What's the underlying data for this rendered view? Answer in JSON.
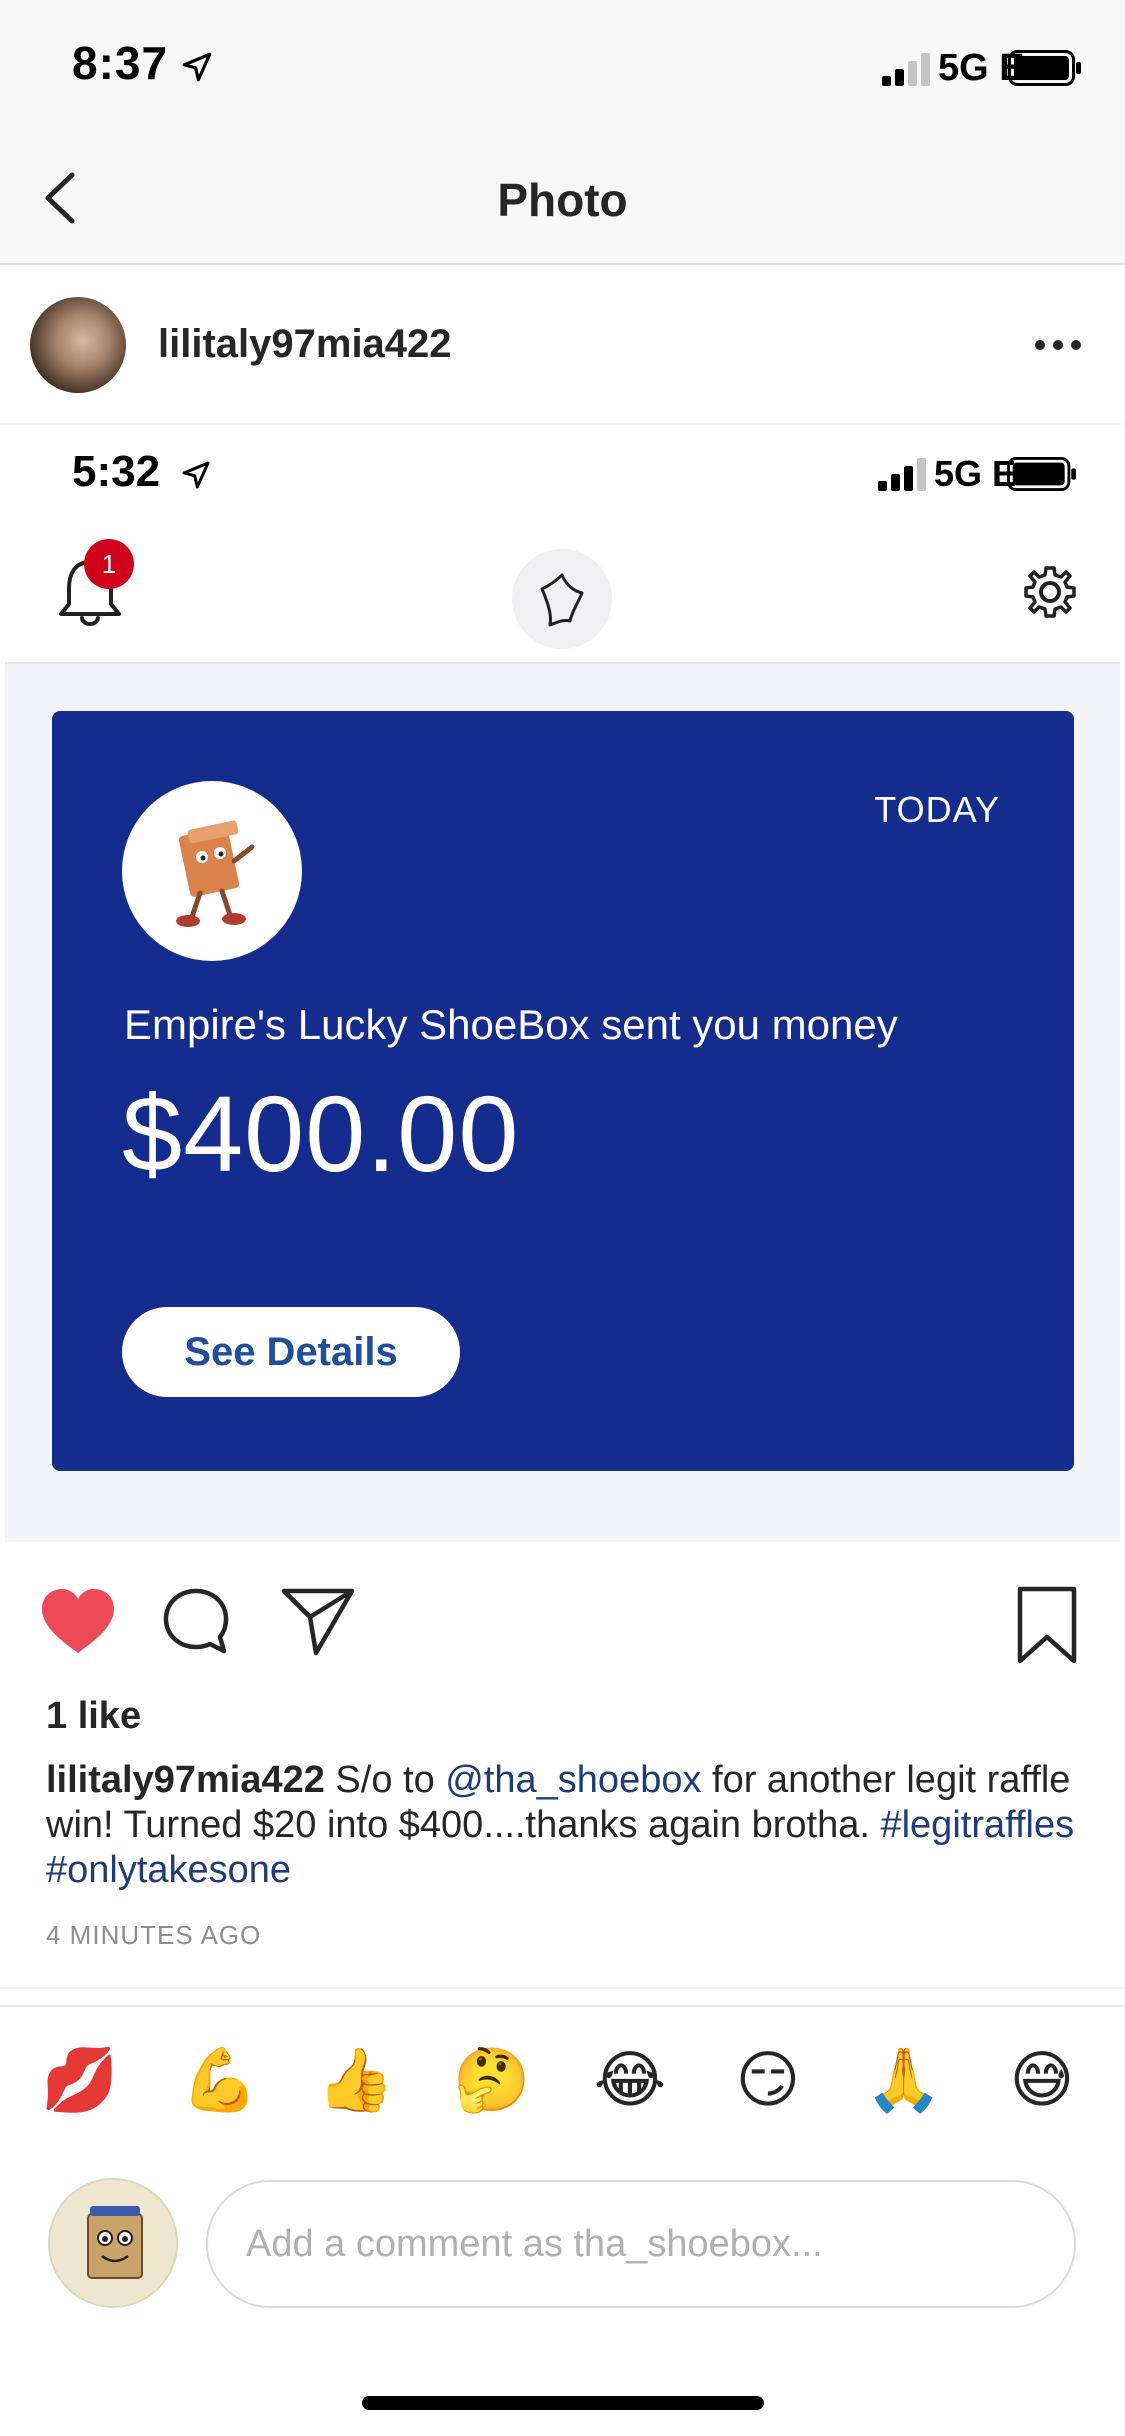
{
  "status_bar": {
    "time": "8:37",
    "network": "5G E"
  },
  "nav": {
    "title": "Photo"
  },
  "post": {
    "username": "lilitaly97mia422",
    "likes": "1 like",
    "caption_user": "lilitaly97mia422",
    "caption_text_1": " S/o to ",
    "caption_mention": "@tha_shoebox",
    "caption_text_2": " for another legit raffle win! Turned $20 into $400....thanks again brotha. ",
    "caption_hashtags": "#legitraffles #onlytakesone",
    "timestamp": "4 MINUTES AGO"
  },
  "inner_screenshot": {
    "status_time": "5:32",
    "network": "5G E",
    "notification_count": "1",
    "card": {
      "date": "TODAY",
      "sender_line": "Empire's Lucky ShoeBox sent you money",
      "amount": "$400.00",
      "button_label": "See Details"
    }
  },
  "emoji_bar": [
    "💋",
    "💪",
    "👍",
    "🤔",
    "😂",
    "😏",
    "🙏",
    "😅"
  ],
  "comment": {
    "placeholder": "Add a comment as tha_shoebox..."
  },
  "colors": {
    "card_blue": "#142c8e",
    "heart_red": "#ed4956",
    "link_blue": "#1f3b7a",
    "badge_red": "#d0021b"
  }
}
